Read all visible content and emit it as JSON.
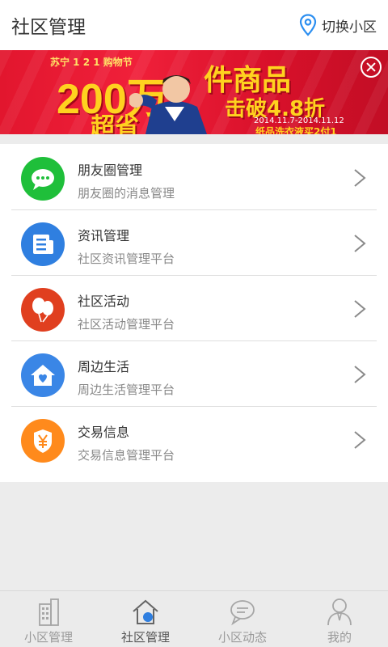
{
  "header": {
    "title": "社区管理",
    "switch_label": "切换小区",
    "switch_icon": "location-pin-icon"
  },
  "banner": {
    "brand": "苏宁 1 2 1 购物节",
    "headline_number": "200万",
    "headline": "件商品",
    "sub_left": "超省",
    "discount": "击破4.8折",
    "date_range": "2014.11.7-2014.11.12",
    "promo": "纸品洗衣液买2付1",
    "close_icon": "close-circle-icon",
    "accent": "#e2162e"
  },
  "menu": [
    {
      "name": "朋友圈管理",
      "desc": "朋友圈的消息管理",
      "icon": "chat-bubble-icon",
      "color": "#1fbf3a"
    },
    {
      "name": "资讯管理",
      "desc": "社区资讯管理平台",
      "icon": "news-icon",
      "color": "#2f7fe0"
    },
    {
      "name": "社区活动",
      "desc": "社区活动管理平台",
      "icon": "balloons-icon",
      "color": "#e03f1f"
    },
    {
      "name": "周边生活",
      "desc": "周边生活管理平台",
      "icon": "home-heart-icon",
      "color": "#3a86e6"
    },
    {
      "name": "交易信息",
      "desc": "交易信息管理平台",
      "icon": "yuan-shield-icon",
      "color": "#ff8a1c"
    }
  ],
  "tabs": [
    {
      "label": "小区管理",
      "icon": "building-icon",
      "active": false
    },
    {
      "label": "社区管理",
      "icon": "house-icon",
      "active": true
    },
    {
      "label": "小区动态",
      "icon": "chat-icon",
      "active": false
    },
    {
      "label": "我的",
      "icon": "person-icon",
      "active": false
    }
  ]
}
